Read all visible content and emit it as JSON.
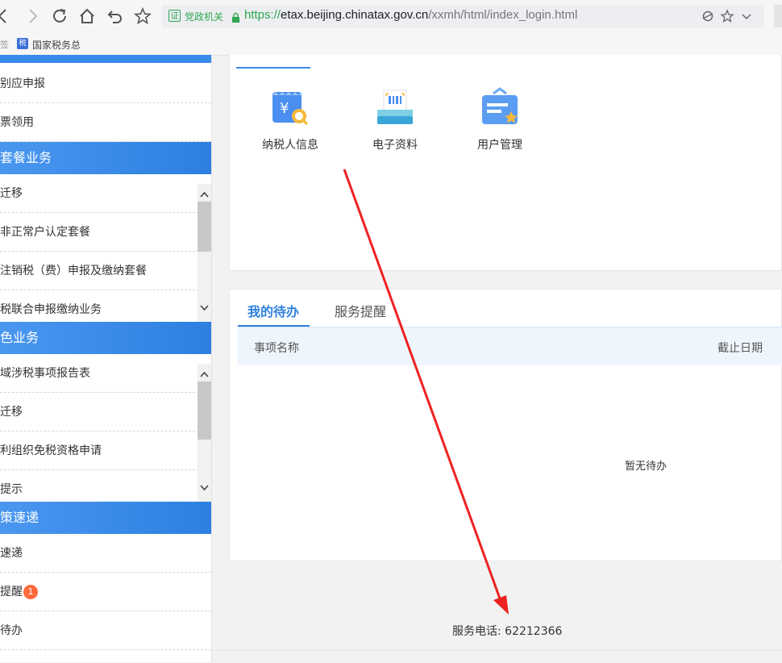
{
  "browser": {
    "cert_label": "证",
    "site_badge": "党政机关",
    "url": {
      "scheme": "https://",
      "host": "etax.beijing.chinatax.gov.cn",
      "path": "/xxmh/html/index_login.html"
    },
    "bookmark_stub": "签",
    "bookmark": {
      "icon_text": "税",
      "label": "国家税务总"
    }
  },
  "sidebar": {
    "section1_items": [
      "别应申报",
      "票领用"
    ],
    "section2": {
      "title": "套餐业务",
      "items": [
        "迁移",
        "非正常户认定套餐",
        "注销税（费）申报及缴纳套餐",
        "税联合申报缴纳业务"
      ]
    },
    "section3": {
      "title": "色业务",
      "items": [
        "域涉税事项报告表",
        "迁移",
        "利组织免税资格申请",
        "提示"
      ]
    },
    "section4": {
      "title": "策速递",
      "items": [
        "速递",
        "提醒",
        "待办"
      ],
      "badge": "1"
    }
  },
  "quick_access": [
    {
      "label": "纳税人信息",
      "icon": "taxpayer-info-icon"
    },
    {
      "label": "电子资料",
      "icon": "electronic-docs-icon"
    },
    {
      "label": "用户管理",
      "icon": "user-management-icon"
    }
  ],
  "todo": {
    "tabs": [
      "我的待办",
      "服务提醒"
    ],
    "columns": [
      "事项名称",
      "截止日期"
    ],
    "empty": "暂无待办"
  },
  "footer": {
    "phone": "服务电话: 62212366"
  },
  "colors": {
    "accent": "#2f80de",
    "sidebar_header": "#3a8aea",
    "annotation": "#ee2222",
    "badge": "#ff6a3d"
  }
}
